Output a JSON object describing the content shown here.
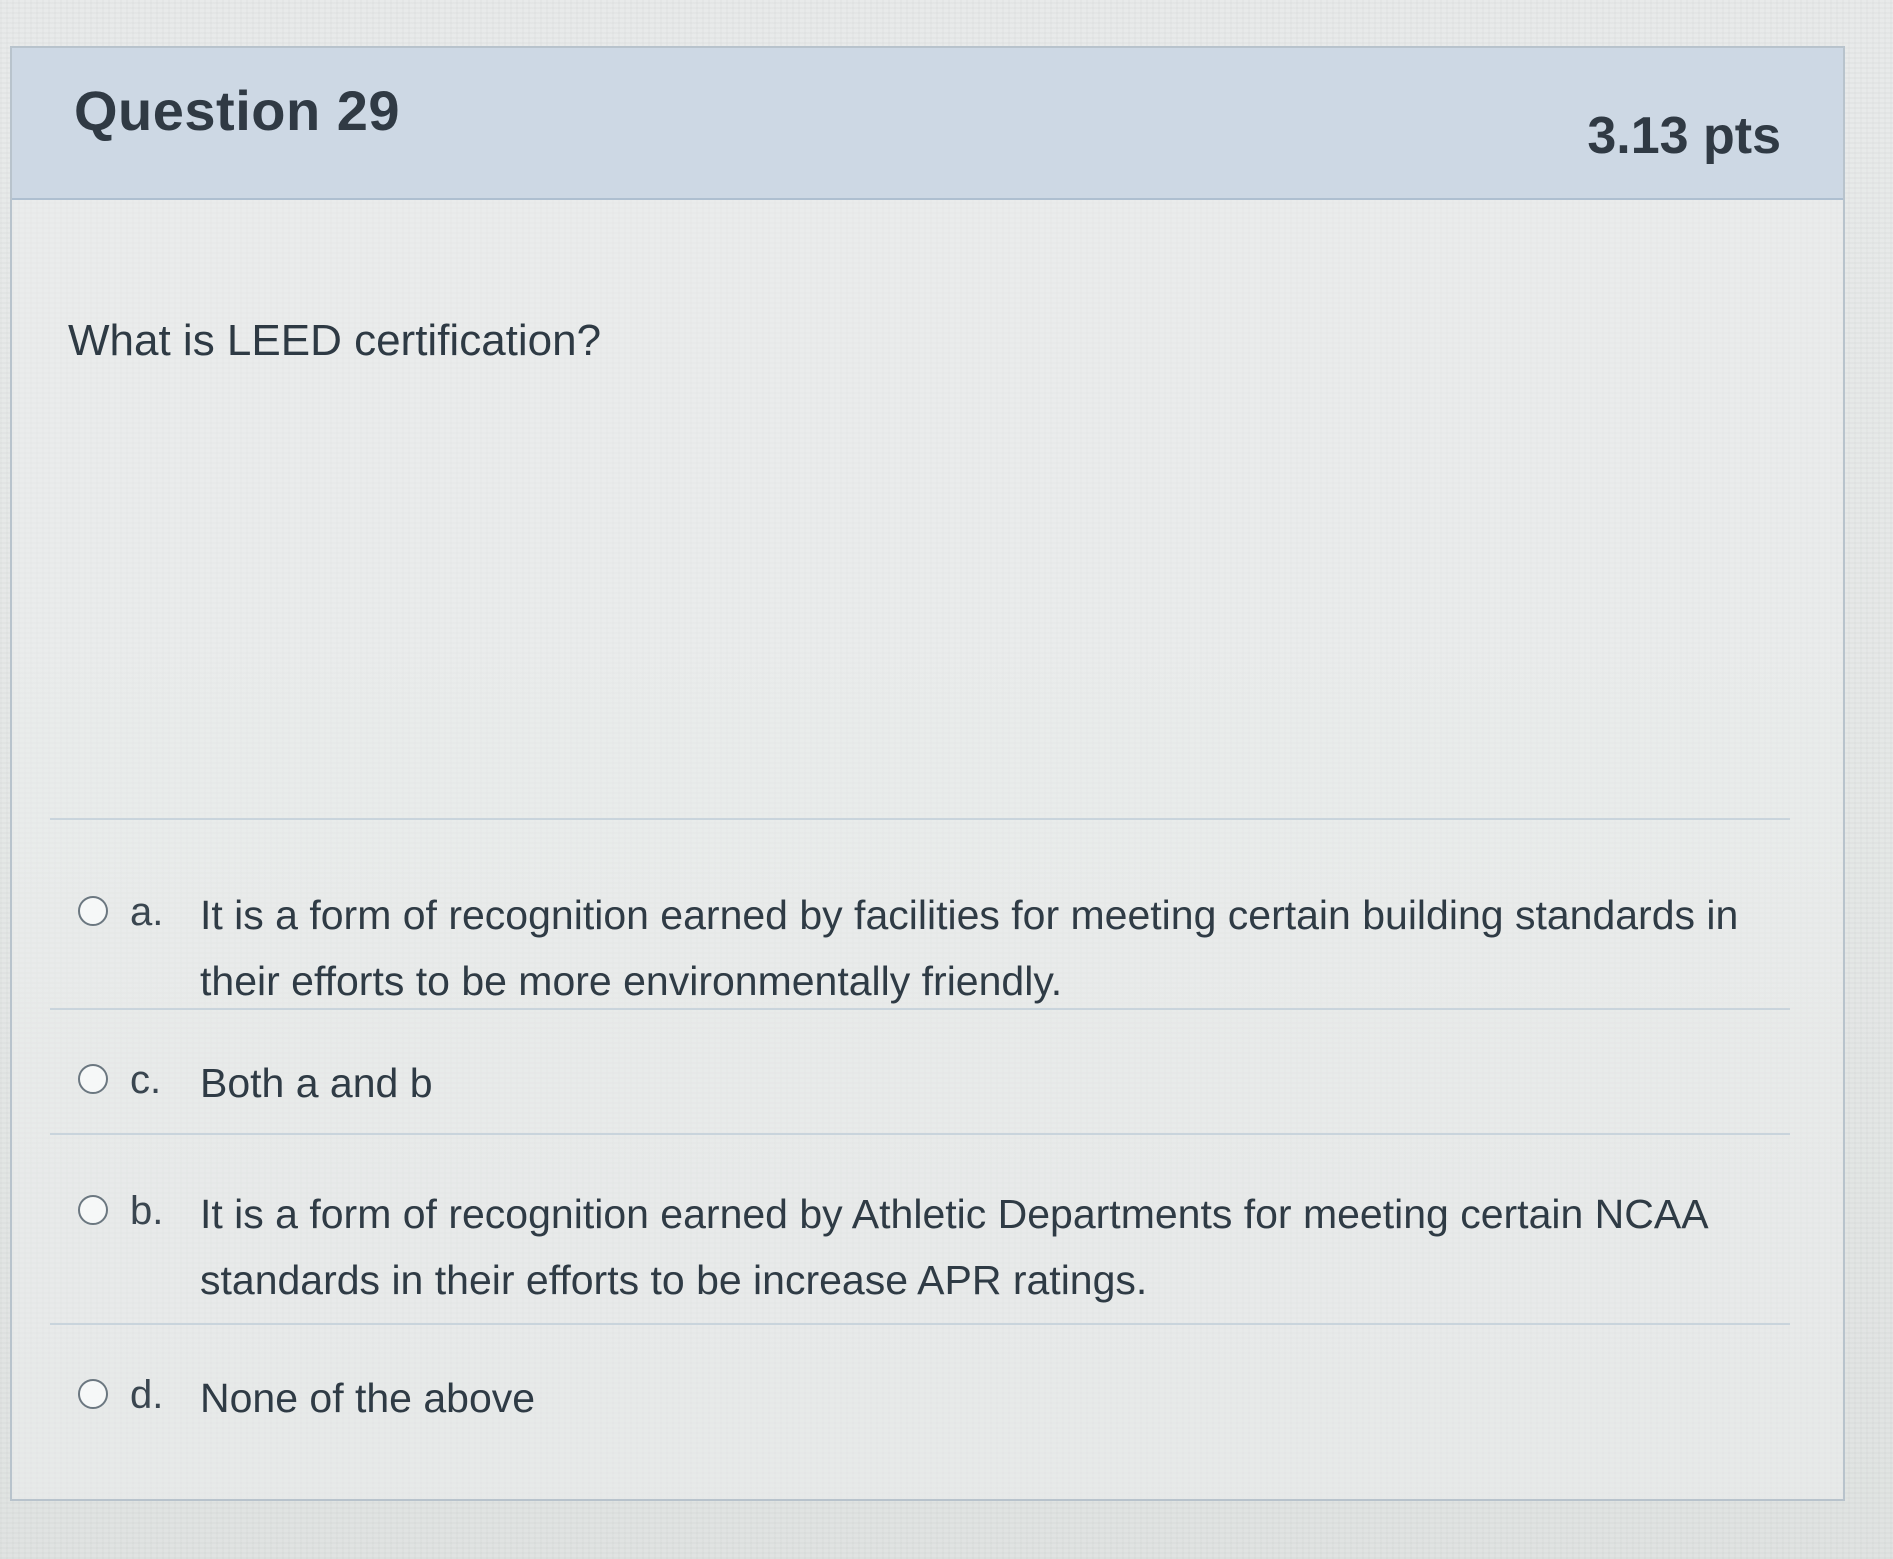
{
  "question": {
    "title": "Question 29",
    "points": "3.13 pts",
    "text": "What is LEED certification?"
  },
  "answers": [
    {
      "letter": "a.",
      "text": "It is a form of recognition earned by facilities for meeting certain building standards in their efforts to be more environmentally friendly."
    },
    {
      "letter": "c.",
      "text": "Both a and b"
    },
    {
      "letter": "b.",
      "text": "It is a form of recognition earned by Athletic Departments for meeting certain NCAA standards in their efforts to be increase APR ratings."
    },
    {
      "letter": "d.",
      "text": "None of the above"
    }
  ]
}
